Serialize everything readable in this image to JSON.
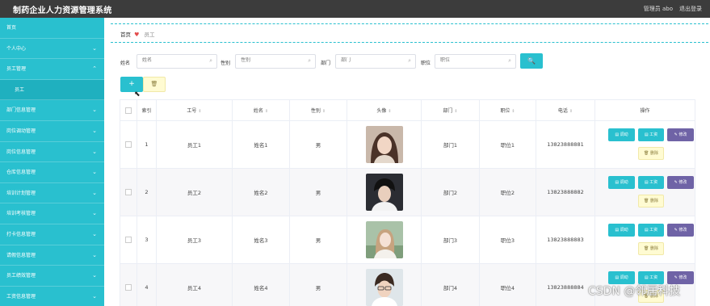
{
  "app": {
    "title": "制药企业人力资源管理系统",
    "user_label": "管理员 abo",
    "logout": "退出登录"
  },
  "colors": {
    "accent": "#29c0cf",
    "purple": "#6f63a6",
    "topbar": "#3c3c3c",
    "warn_bg": "#fffbd2"
  },
  "sidebar": {
    "items": [
      {
        "label": "首页",
        "chevron": false
      },
      {
        "label": "个人中心",
        "chevron": true
      },
      {
        "label": "员工管理",
        "chevron": true,
        "expanded": true
      },
      {
        "label": "员工",
        "chevron": false,
        "sub": true
      },
      {
        "label": "部门信息管理",
        "chevron": true
      },
      {
        "label": "岗位调动管理",
        "chevron": true
      },
      {
        "label": "岗位信息管理",
        "chevron": true
      },
      {
        "label": "仓库信息管理",
        "chevron": true
      },
      {
        "label": "培训计划管理",
        "chevron": true
      },
      {
        "label": "培训考核管理",
        "chevron": true
      },
      {
        "label": "打卡信息管理",
        "chevron": true
      },
      {
        "label": "请假信息管理",
        "chevron": true
      },
      {
        "label": "员工绩效管理",
        "chevron": true
      },
      {
        "label": "工资信息管理",
        "chevron": true
      }
    ]
  },
  "breadcrumb": {
    "home": "首页",
    "current": "员工"
  },
  "filters": {
    "name": {
      "label": "姓名",
      "placeholder": "姓名"
    },
    "gender": {
      "label": "性别",
      "placeholder": "性别"
    },
    "dept": {
      "label": "部门",
      "placeholder": "部门"
    },
    "post": {
      "label": "职位",
      "placeholder": "职位"
    }
  },
  "buttons": {
    "search": "🔍",
    "add": "+",
    "delete": "🗑"
  },
  "table": {
    "headers": [
      "",
      "索引",
      "工号",
      "姓名",
      "性别",
      "头像",
      "部门",
      "职位",
      "电话",
      "操作"
    ],
    "rows": [
      {
        "index": "1",
        "code": "员工1",
        "name": "姓名1",
        "gender": "男",
        "dept": "部门1",
        "post": "职位1",
        "phone": "13823888881"
      },
      {
        "index": "2",
        "code": "员工2",
        "name": "姓名2",
        "gender": "男",
        "dept": "部门2",
        "post": "职位2",
        "phone": "13823888882"
      },
      {
        "index": "3",
        "code": "员工3",
        "name": "姓名3",
        "gender": "男",
        "dept": "部门3",
        "post": "职位3",
        "phone": "13823888883"
      },
      {
        "index": "4",
        "code": "员工4",
        "name": "姓名4",
        "gender": "男",
        "dept": "部门4",
        "post": "职位4",
        "phone": "13823888884"
      }
    ],
    "ops": {
      "transfer": "调动",
      "salary": "工资",
      "edit": "修改",
      "delete": "删除"
    }
  },
  "watermark": "CSDN @邻居科技"
}
